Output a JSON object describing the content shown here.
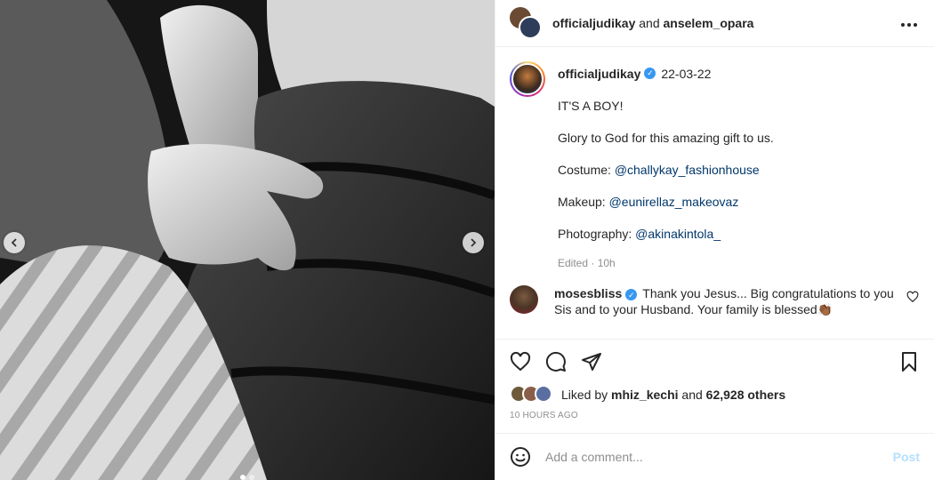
{
  "header": {
    "author": "officialjudikay",
    "joiner": "and",
    "coauthor": "anselem_opara",
    "more_icon": "more-horizontal-icon"
  },
  "caption": {
    "username": "officialjudikay",
    "date": "22-03-22",
    "lines": [
      {
        "text": "IT'S A BOY!",
        "label": "",
        "mention": ""
      },
      {
        "text": "Glory to God for this amazing gift to us.",
        "label": "",
        "mention": ""
      },
      {
        "text": "",
        "label": "Costume: ",
        "mention": "@challykay_fashionhouse"
      },
      {
        "text": "",
        "label": "Makeup: ",
        "mention": "@eunirellaz_makeovaz"
      },
      {
        "text": "",
        "label": "Photography: ",
        "mention": "@akinakintola_"
      }
    ],
    "edited": "Edited · 10h"
  },
  "comment": {
    "username": "mosesbliss",
    "text": "Thank you Jesus... Big congratulations to you Sis and to your Husband. Your family is blessed👏🏾"
  },
  "likes": {
    "prefix": "Liked by",
    "user": "mhiz_kechi",
    "joiner": "and",
    "others": "62,928 others"
  },
  "timestamp": "10 HOURS AGO",
  "composer": {
    "placeholder": "Add a comment...",
    "post_label": "Post"
  },
  "carousel": {
    "dots": 2,
    "active": 0
  },
  "colors": {
    "link": "#00376b",
    "verified": "#3897f0",
    "post_disabled": "#b2dffc",
    "muted": "#8e8e8e"
  }
}
